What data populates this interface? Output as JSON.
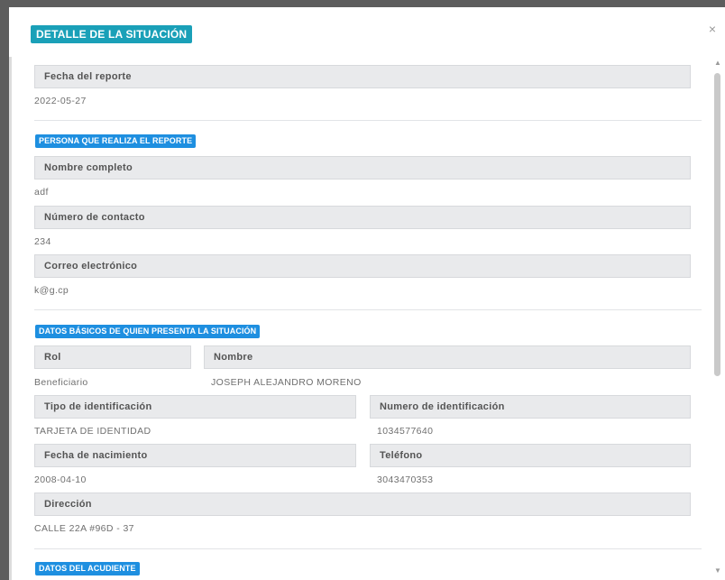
{
  "modal": {
    "title": "DETALLE DE LA SITUACIÓN",
    "close_glyph": "×"
  },
  "report": {
    "date_label": "Fecha del reporte",
    "date_value": "2022-05-27"
  },
  "reporter": {
    "section_title": "PERSONA QUE REALIZA EL REPORTE",
    "name_label": "Nombre completo",
    "name_value": "adf",
    "phone_label": "Número de contacto",
    "phone_value": "234",
    "email_label": "Correo electrónico",
    "email_value": "k@g.cp"
  },
  "subject": {
    "section_title": "DATOS BÁSICOS DE QUIEN PRESENTA LA SITUACIÓN",
    "role_label": "Rol",
    "role_value": "Beneficiario",
    "name_label": "Nombre",
    "name_value": "JOSEPH ALEJANDRO MORENO",
    "id_type_label": "Tipo de identificación",
    "id_type_value": "TARJETA DE IDENTIDAD",
    "id_number_label": "Numero de identificación",
    "id_number_value": "1034577640",
    "birth_label": "Fecha de nacimiento",
    "birth_value": "2008-04-10",
    "phone_label": "Teléfono",
    "phone_value": "3043470353",
    "address_label": "Dirección",
    "address_value": "CALLE 22A #96D - 37"
  },
  "guardian": {
    "section_title": "DATOS DEL ACUDIENTE"
  },
  "scrollbar": {
    "up_glyph": "▲",
    "down_glyph": "▼"
  }
}
